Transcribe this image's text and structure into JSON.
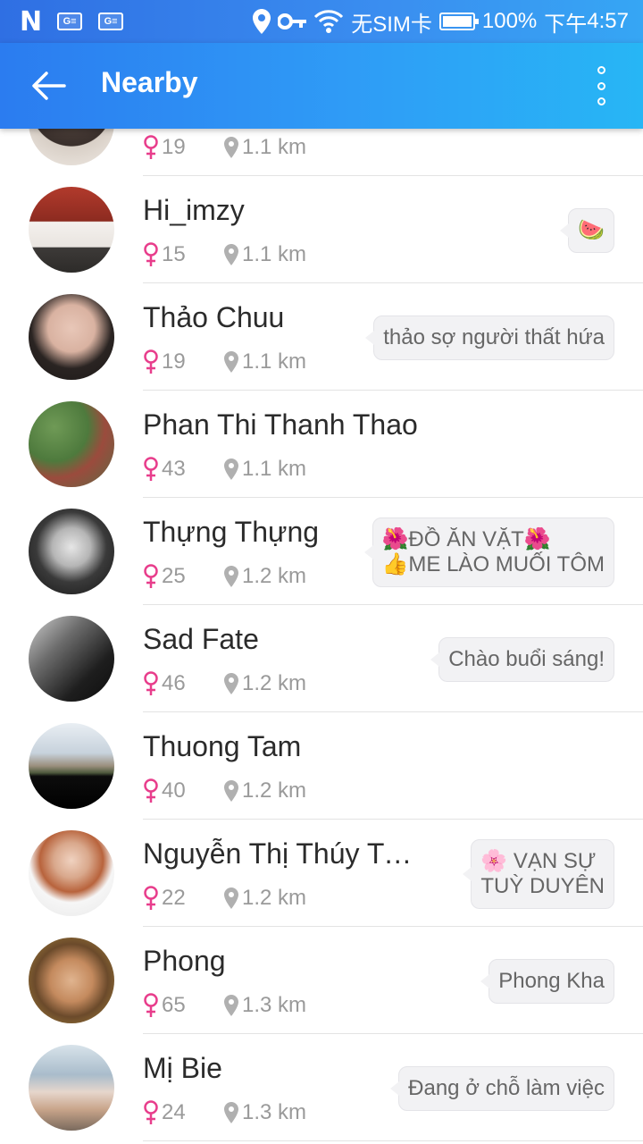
{
  "status_bar": {
    "n_label": "N",
    "sim1": "G",
    "sim2": "G",
    "no_sim": "无SIM卡",
    "battery": "100%",
    "time_prefix": "下午",
    "time": "4:57"
  },
  "app_bar": {
    "title": "Nearby"
  },
  "rows": [
    {
      "name": "",
      "age": "19",
      "distance": "1.1 km",
      "message": ""
    },
    {
      "name": "Hi_imzy",
      "age": "15",
      "distance": "1.1 km",
      "message": "🍉"
    },
    {
      "name": "Thảo Chuu",
      "age": "19",
      "distance": "1.1 km",
      "message": "thảo sợ người thất hứa"
    },
    {
      "name": "Phan Thi Thanh Thao",
      "age": "43",
      "distance": "1.1 km",
      "message": ""
    },
    {
      "name": "Thựng Thựng",
      "age": "25",
      "distance": "1.2 km",
      "message_line1": "🌺ĐỒ ĂN VẶT🌺",
      "message_line2": "👍ME LÀO MUỐI TÔM"
    },
    {
      "name": "Sad Fate",
      "age": "46",
      "distance": "1.2 km",
      "message": "Chào buổi sáng!"
    },
    {
      "name": "Thuong Tam",
      "age": "40",
      "distance": "1.2 km",
      "message": ""
    },
    {
      "name": "Nguyễn Thị Thúy Tri...",
      "age": "22",
      "distance": "1.2 km",
      "message_line1": "🌸 VẠN SỰ",
      "message_line2": "TUỲ DUYÊN"
    },
    {
      "name": "Phong",
      "age": "65",
      "distance": "1.3 km",
      "message": "Phong Kha"
    },
    {
      "name": "Mị Bie",
      "age": "24",
      "distance": "1.3 km",
      "message": "Đang ở chỗ làm việc"
    }
  ],
  "colors": {
    "accent": "#2f8cf2",
    "female": "#e83e8c",
    "meta": "#9a9a9a"
  }
}
